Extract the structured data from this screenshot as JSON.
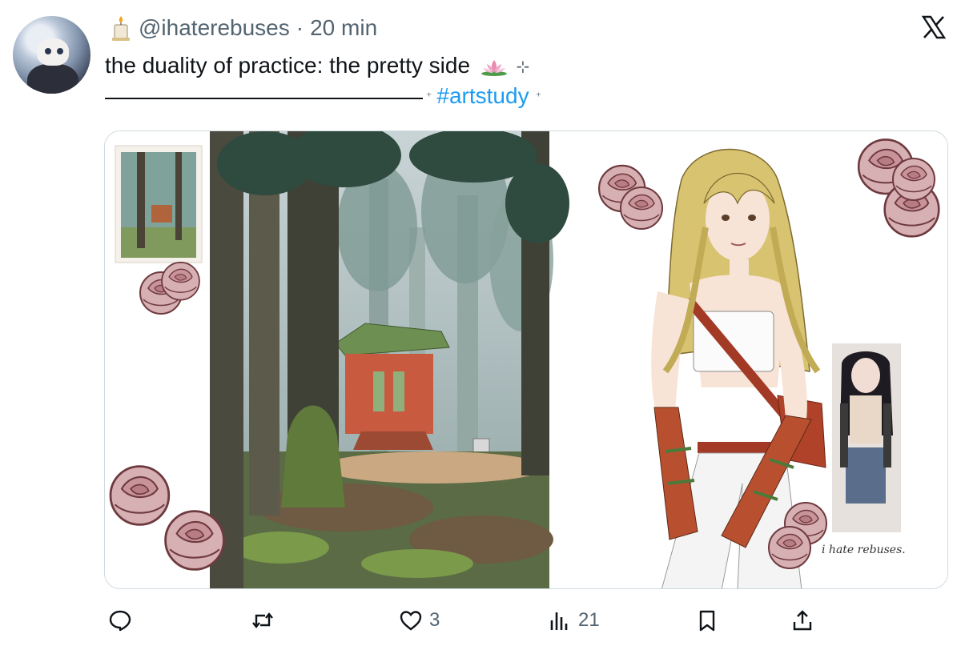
{
  "author": {
    "handle": "@ihaterebuses",
    "separator": "·",
    "time": "20 min",
    "avatar_icon": "avatar-anime-character",
    "badge_icon": "candle-icon"
  },
  "tweet": {
    "text": "the duality of practice: the pretty side",
    "emoji_icon": "lotus-icon",
    "sparkle": "⊹",
    "line_sparkle_left": "⁺",
    "hashtag": "#artstudy",
    "line_sparkle_right": "⁺"
  },
  "media": {
    "watermark": "i hate rebuses.",
    "panels": [
      "forest-shrine-painting",
      "anime-girl-illustration"
    ]
  },
  "actions": {
    "reply_count": "",
    "retweet_count": "",
    "like_count": "3",
    "views_count": "21"
  },
  "colors": {
    "link": "#1d9bf0",
    "muted": "#536471",
    "text": "#0f1419",
    "rose": "#c9a0a4"
  }
}
